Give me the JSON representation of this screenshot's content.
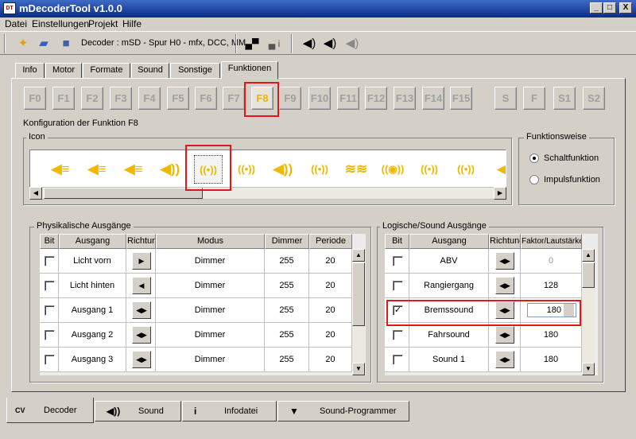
{
  "window": {
    "title": "mDecoderTool v1.0.0",
    "app_icon_text": "DT",
    "min": "_",
    "max": "□",
    "close": "X"
  },
  "menu": [
    "Datei",
    "Einstellungen",
    "Projekt",
    "Hilfe"
  ],
  "toolbar": {
    "decoder_label": "Decoder : mSD - Spur H0 - mfx, DCC, MM",
    "info_glyph": "i"
  },
  "tabs": [
    "Info",
    "Motor",
    "Formate",
    "Sound",
    "Sonstige",
    "Funktionen"
  ],
  "active_tab": "Funktionen",
  "function_buttons": [
    "F0",
    "F1",
    "F2",
    "F3",
    "F4",
    "F5",
    "F6",
    "F7",
    "F8",
    "F9",
    "F10",
    "F11",
    "F12",
    "F13",
    "F14",
    "F15"
  ],
  "special_buttons": [
    "S",
    "F",
    "S1",
    "S2"
  ],
  "selected_function": "F8",
  "config": {
    "title": "Konfiguration der Funktion F8",
    "icon_group_label": "Icon",
    "mode_group_label": "Funktionsweise",
    "modes": [
      {
        "label": "Schaltfunktion",
        "selected": true
      },
      {
        "label": "Impulsfunktion",
        "selected": false
      }
    ]
  },
  "icons": [
    "headlight-icon",
    "lamp-icon",
    "light-bar-icon",
    "horn-icon",
    "brake-sound-icon",
    "bell-icon",
    "sound-icon",
    "whistle-icon",
    "fan-icon",
    "pump-icon",
    "compressor-icon",
    "sanding-icon",
    "speaker-icon"
  ],
  "icon_glyphs": [
    "◀≡",
    "◀≡",
    "◀≡",
    "◀))",
    "((•))",
    "((•))",
    "◀))",
    "((•))",
    "≋≋",
    "((◉))",
    "((•))",
    "((•))",
    "◀"
  ],
  "selected_icon": 4,
  "scroll_glyphs": {
    "left": "◀",
    "right": "▶",
    "up": "▲",
    "down": "▼"
  },
  "physical": {
    "label": "Physikalische Ausgänge",
    "columns": [
      "Bit",
      "Ausgang",
      "Richtung",
      "Modus",
      "Dimmer",
      "Periode"
    ],
    "rows": [
      {
        "checked": false,
        "name": "Licht vorn",
        "dir": "▶",
        "mode": "Dimmer",
        "dimmer": "255",
        "period": "20"
      },
      {
        "checked": false,
        "name": "Licht hinten",
        "dir": "◀",
        "mode": "Dimmer",
        "dimmer": "255",
        "period": "20"
      },
      {
        "checked": false,
        "name": "Ausgang 1",
        "dir": "◀▶",
        "mode": "Dimmer",
        "dimmer": "255",
        "period": "20"
      },
      {
        "checked": false,
        "name": "Ausgang 2",
        "dir": "◀▶",
        "mode": "Dimmer",
        "dimmer": "255",
        "period": "20"
      },
      {
        "checked": false,
        "name": "Ausgang 3",
        "dir": "◀▶",
        "mode": "Dimmer",
        "dimmer": "255",
        "period": "20"
      }
    ]
  },
  "logic": {
    "label": "Logische/Sound Ausgänge",
    "columns": [
      "Bit",
      "Ausgang",
      "Richtung",
      "Faktor/Lautstärke"
    ],
    "rows": [
      {
        "checked": false,
        "name": "ABV",
        "dir": "◀▶",
        "value": "0",
        "disabled": true
      },
      {
        "checked": false,
        "name": "Rangiergang",
        "dir": "◀▶",
        "value": "128"
      },
      {
        "checked": true,
        "name": "Bremssound",
        "dir": "◀▶",
        "value": "180",
        "editing": true
      },
      {
        "checked": false,
        "name": "Fahrsound",
        "dir": "◀▶",
        "value": "180"
      },
      {
        "checked": false,
        "name": "Sound 1",
        "dir": "◀▶",
        "value": "180"
      }
    ]
  },
  "bottom_tabs": [
    {
      "label": "Decoder",
      "icon": "cv-decoder-icon",
      "glyph": "CV",
      "active": true
    },
    {
      "label": "Sound",
      "icon": "speaker-icon",
      "glyph": "◀))",
      "active": false
    },
    {
      "label": "Infodatei",
      "icon": "info-icon",
      "glyph": "i",
      "active": false
    },
    {
      "label": "Sound-Programmer",
      "icon": "sound-programmer-icon",
      "glyph": "▼",
      "active": false
    }
  ],
  "colors": {
    "icon_yellow": "#f0b800",
    "highlight_red": "#e01818",
    "titlebar": "#0a2a8a"
  }
}
